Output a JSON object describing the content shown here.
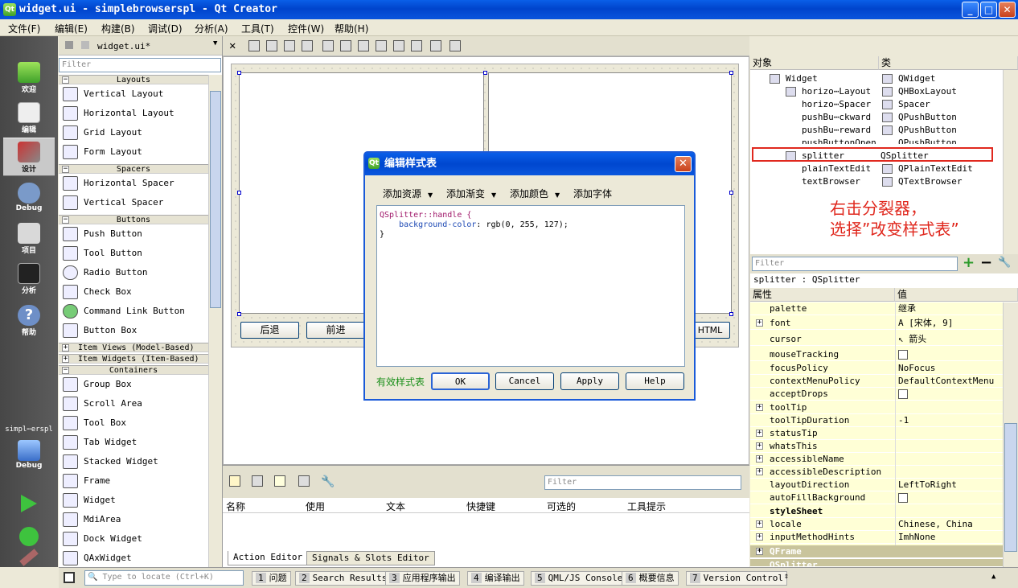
{
  "window": {
    "title": "widget.ui - simplebrowserspl - Qt Creator"
  },
  "menubar": [
    "文件(F)",
    "编辑(E)",
    "构建(B)",
    "调试(D)",
    "分析(A)",
    "工具(T)",
    "控件(W)",
    "帮助(H)"
  ],
  "modes": [
    {
      "label": "欢迎"
    },
    {
      "label": "编辑"
    },
    {
      "label": "设计"
    },
    {
      "label": "Debug"
    },
    {
      "label": "项目"
    },
    {
      "label": "分析"
    },
    {
      "label": "帮助"
    }
  ],
  "target": {
    "project": "simpl⋯erspl",
    "config": "Debug"
  },
  "widgetbox": {
    "file_tab": "widget.ui*",
    "filter_placeholder": "Filter",
    "categories": {
      "layouts": "Layouts",
      "spacers": "Spacers",
      "buttons": "Buttons",
      "itemviews": "Item Views (Model-Based)",
      "itemwidgets": "Item Widgets (Item-Based)",
      "containers": "Containers"
    },
    "layouts": [
      "Vertical Layout",
      "Horizontal Layout",
      "Grid Layout",
      "Form Layout"
    ],
    "spacers": [
      "Horizontal Spacer",
      "Vertical Spacer"
    ],
    "buttons": [
      "Push Button",
      "Tool Button",
      "Radio Button",
      "Check Box",
      "Command Link Button",
      "Button Box"
    ],
    "containers": [
      "Group Box",
      "Scroll Area",
      "Tool Box",
      "Tab Widget",
      "Stacked Widget",
      "Frame",
      "Widget",
      "MdiArea",
      "Dock Widget",
      "QAxWidget"
    ]
  },
  "form": {
    "buttons": [
      "后退",
      "前进",
      "HTML"
    ]
  },
  "dialog": {
    "title": "编辑样式表",
    "menus": [
      "添加资源",
      "添加渐变",
      "添加颜色",
      "添加字体"
    ],
    "code_selector": "QSplitter::handle {",
    "code_property": "background-color",
    "code_value": ": rgb(0, 255, 127);",
    "code_close": "}",
    "status": "有效样式表",
    "buttons": {
      "ok": "OK",
      "cancel": "Cancel",
      "apply": "Apply",
      "help": "Help"
    }
  },
  "action_editor": {
    "filter_placeholder": "Filter",
    "columns": [
      "名称",
      "使用",
      "文本",
      "快捷键",
      "可选的",
      "工具提示"
    ],
    "tabs": [
      "Action Editor",
      "Signals & Slots Editor"
    ]
  },
  "object_inspector": {
    "headers": [
      "对象",
      "类"
    ],
    "rows": [
      {
        "name": "Widget",
        "class": "QWidget"
      },
      {
        "name": "horizo⋯Layout",
        "class": "QHBoxLayout"
      },
      {
        "name": "horizo⋯Spacer",
        "class": "Spacer"
      },
      {
        "name": "pushBu⋯ckward",
        "class": "QPushButton"
      },
      {
        "name": "pushBu⋯reward",
        "class": "QPushButton"
      },
      {
        "name": "pushButtonOpen",
        "class": "QPushButton"
      },
      {
        "name": "splitter",
        "class": "QSplitter"
      },
      {
        "name": "plainTextEdit",
        "class": "QPlainTextEdit"
      },
      {
        "name": "textBrowser",
        "class": "QTextBrowser"
      }
    ]
  },
  "annotation": {
    "line1": "右击分裂器，",
    "line2": "选择”改变样式表”"
  },
  "property_editor": {
    "filter_placeholder": "Filter",
    "object_label": "splitter : QSplitter",
    "headers": [
      "属性",
      "值"
    ],
    "rows": [
      {
        "name": "palette",
        "value": "继承"
      },
      {
        "name": "font",
        "value": "[宋体, 9]"
      },
      {
        "name": "cursor",
        "value": "箭头"
      },
      {
        "name": "mouseTracking",
        "value": ""
      },
      {
        "name": "focusPolicy",
        "value": "NoFocus"
      },
      {
        "name": "contextMenuPolicy",
        "value": "DefaultContextMenu"
      },
      {
        "name": "acceptDrops",
        "value": ""
      },
      {
        "name": "toolTip",
        "value": ""
      },
      {
        "name": "toolTipDuration",
        "value": "-1"
      },
      {
        "name": "statusTip",
        "value": ""
      },
      {
        "name": "whatsThis",
        "value": ""
      },
      {
        "name": "accessibleName",
        "value": ""
      },
      {
        "name": "accessibleDescription",
        "value": ""
      },
      {
        "name": "layoutDirection",
        "value": "LeftToRight"
      },
      {
        "name": "autoFillBackground",
        "value": ""
      },
      {
        "name": "styleSheet",
        "value": ""
      },
      {
        "name": "locale",
        "value": "Chinese, China"
      },
      {
        "name": "inputMethodHints",
        "value": "ImhNone"
      }
    ],
    "groups": [
      "QFrame",
      "QSplitter"
    ]
  },
  "statusbar": {
    "locate_placeholder": "Type to locate (Ctrl+K)",
    "panes": [
      {
        "n": "1",
        "label": "问题"
      },
      {
        "n": "2",
        "label": "Search Results"
      },
      {
        "n": "3",
        "label": "应用程序输出"
      },
      {
        "n": "4",
        "label": "编译输出"
      },
      {
        "n": "5",
        "label": "QML/JS Console"
      },
      {
        "n": "6",
        "label": "概要信息"
      },
      {
        "n": "7",
        "label": "Version Control"
      }
    ]
  },
  "colors": {
    "accent": "#0a5fe8",
    "annotation": "#e0281e",
    "property_bg": "#ffffd6",
    "property_group": "#c9c49c",
    "highlight_box": "#e0281e"
  }
}
